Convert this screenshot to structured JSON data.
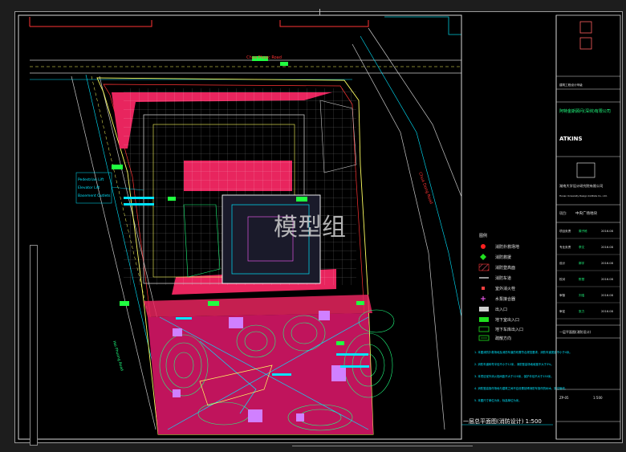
{
  "watermark": "模型组",
  "drawing_title": "一层总平面图(消防设计) 1:500",
  "street_labels": {
    "north_road": "Chua Phuoc Road",
    "east_road": "Chua Dong Road",
    "west_road": "Hai Phuong Road"
  },
  "building_callout": {
    "lines": [
      "Pedestrian Lift",
      "Elevator Lift",
      "Basement Outlets"
    ]
  },
  "legend": {
    "items": [
      {
        "label": "消防扑救场地",
        "color": "#ff2020",
        "icon": "red-dot-icon"
      },
      {
        "label": "消防救援",
        "color": "#20e020",
        "icon": "green-diamond-icon"
      },
      {
        "label": "消防登高面",
        "color": "#ff3030",
        "icon": "red-hatch-icon"
      },
      {
        "label": "消防车道",
        "color": "#c8c8c8",
        "icon": "gray-line-icon"
      },
      {
        "label": "室外消火栓",
        "color": "#ff4040",
        "icon": "small-red-mark-icon"
      },
      {
        "label": "水泵接合器",
        "color": "#ff60ff",
        "icon": "pink-mark-icon"
      },
      {
        "label": "出入口",
        "color": "#d0d0d0",
        "icon": "white-rect-icon"
      },
      {
        "label": "地下室出入口",
        "color": "#20e020",
        "icon": "green-rect-icon"
      },
      {
        "label": "地下车库出入口",
        "color": "#20e020",
        "icon": "green-outline-icon"
      },
      {
        "label": "疏散方向",
        "color": "#20e020",
        "icon": "green-frame-icon"
      }
    ]
  },
  "notes": [
    "1. 本图消防扑救场地及消防车道的布置符合规范要求，消防车道宽度不小于4米。",
    "2. 消防车道转弯半径不小于12米，消防登高场地坡度不大于3%。",
    "3. 本项目室外消火栓间距不大于120米，保护半径不大于150米。",
    "4. 消防登高操作场地与建筑之间不应设置妨碍消防车操作的树木、架空管线。",
    "5. 本图尺寸单位为米，标高单位为米。"
  ],
  "title_block": {
    "company_cn": "阿特金斯顾问(深圳)有限公司",
    "company_cn_2": "建筑工程设计甲级",
    "company_en": "ATKINS",
    "institute_cn": "湖南大学设计研究院有限公司",
    "institute_en": "Hunan University Design Institute Co., Ltd.",
    "project_label": "项目:",
    "project_name": "中央广场地块",
    "drawing_name": "一层平面图(消防设计)",
    "rows": [
      {
        "role": "项目负责",
        "name": "周子栋",
        "date": "2016.08"
      },
      {
        "role": "专业负责",
        "name": "李文",
        "date": "2016.08"
      },
      {
        "role": "设计",
        "name": "郭宇",
        "date": "2016.08"
      },
      {
        "role": "校对",
        "name": "陈慧",
        "date": "2016.08"
      },
      {
        "role": "审核",
        "name": "刘浩",
        "date": "2016.08"
      },
      {
        "role": "审定",
        "name": "张力",
        "date": "2016.08"
      }
    ],
    "sheet_no": "ZP-05",
    "scale": "1:500"
  },
  "colors": {
    "background": "#000000",
    "frame": "#d8d8d8",
    "fire_lane": "#ff2d6a",
    "grid": "#ffffff",
    "road_edge": "#ffff60",
    "landscape": "#20ff80",
    "accent_cyan": "#00e5ff",
    "boundary": "#ff3333"
  }
}
